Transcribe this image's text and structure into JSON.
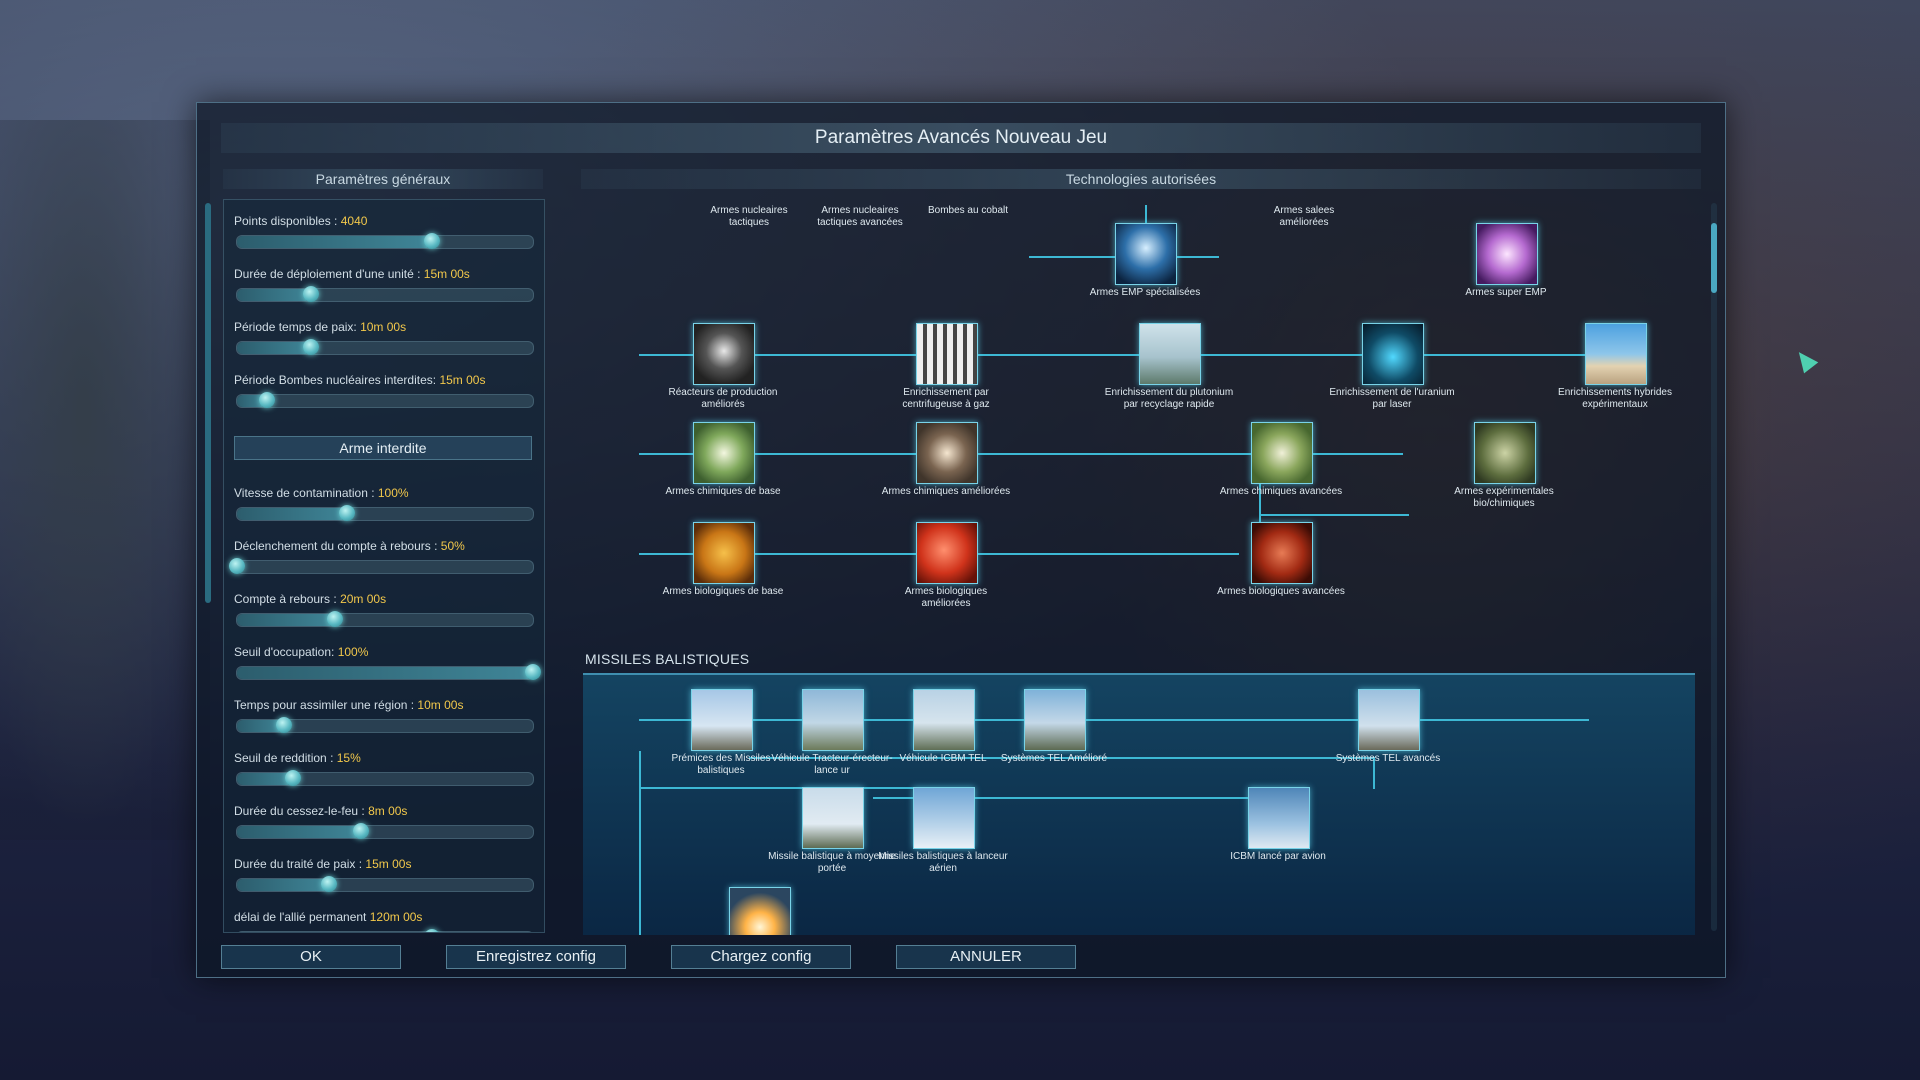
{
  "dialog": {
    "title": "Paramètres Avancés Nouveau Jeu"
  },
  "general": {
    "header": "Paramètres généraux",
    "forbidden_weapon_button": "Arme interdite",
    "settings": [
      {
        "label": "Points disponibles : ",
        "value": "4040",
        "level": 0.66
      },
      {
        "label": "Durée de déploiement d'une unité : ",
        "value": "15m 00s",
        "level": 0.25
      },
      {
        "label": "Période temps de paix: ",
        "value": "10m 00s",
        "level": 0.25
      },
      {
        "label": "Période Bombes nucléaires interdites: ",
        "value": "15m 00s",
        "level": 0.1
      },
      {
        "label": "Vitesse de contamination : ",
        "value": "100%",
        "level": 0.37
      },
      {
        "label": "Déclenchement du compte à rebours : ",
        "value": "50%",
        "level": 0.0
      },
      {
        "label": "Compte à rebours : ",
        "value": "20m 00s",
        "level": 0.33
      },
      {
        "label": "Seuil d'occupation: ",
        "value": "100%",
        "level": 1.0
      },
      {
        "label": "Temps pour assimiler une région : ",
        "value": "10m 00s",
        "level": 0.16
      },
      {
        "label": "Seuil de reddition : ",
        "value": "15%",
        "level": 0.19
      },
      {
        "label": "Durée du cessez-le-feu : ",
        "value": "8m 00s",
        "level": 0.42
      },
      {
        "label": "Durée du traité de paix : ",
        "value": "15m 00s",
        "level": 0.31
      },
      {
        "label": "délai de l'allié permanent ",
        "value": "120m 00s",
        "level": 0.66
      }
    ]
  },
  "tech": {
    "header": "Technologies autorisées",
    "top_labels": [
      "Armes nucleaires tactiques",
      "Armes nucleaires tactiques avancées",
      "Bombes au cobalt",
      "Armes salees améliorées"
    ],
    "nodes": {
      "emp": "Armes EMP spécialisées",
      "superemp": "Armes super EMP",
      "reactor": "Réacteurs de production améliorés",
      "gas": "Enrichissement par centrifugeuse à gaz",
      "plutonium": "Enrichissement du plutonium par recyclage rapide",
      "laser": "Enrichissement de l'uranium par laser",
      "hybrid": "Enrichissements hybrides expérimentaux",
      "chem1": "Armes chimiques de base",
      "chem2": "Armes chimiques améliorées",
      "chem3": "Armes chimiques avancées",
      "expbio": "Armes expérimentales bio/chimiques",
      "bio1": "Armes biologiques de base",
      "bio2": "Armes biologiques améliorées",
      "bio3": "Armes biologiques avancées"
    },
    "ballistic": {
      "title": "MISSILES BALISTIQUES",
      "nodes": {
        "premices": "Prémices des Missiles balistiques",
        "tel": "Véhicule Tracteur-érecteur-lance ur",
        "icbmtel": "Véhicule ICBM TEL",
        "telplus": "Systèmes TEL Amélioré",
        "teladv": "Systèmes TEL avancés",
        "mrbm": "Missile balistique à moyenne portée",
        "alaunch": "Missiles balistiques à lanceur aérien",
        "aicbm": "ICBM lancé par avion"
      }
    }
  },
  "buttons": {
    "ok": "OK",
    "save": "Enregistrez config",
    "load": "Chargez config",
    "cancel": "ANNULER"
  },
  "colors": {
    "accent": "#3db8d4",
    "value": "#f2c84b"
  }
}
